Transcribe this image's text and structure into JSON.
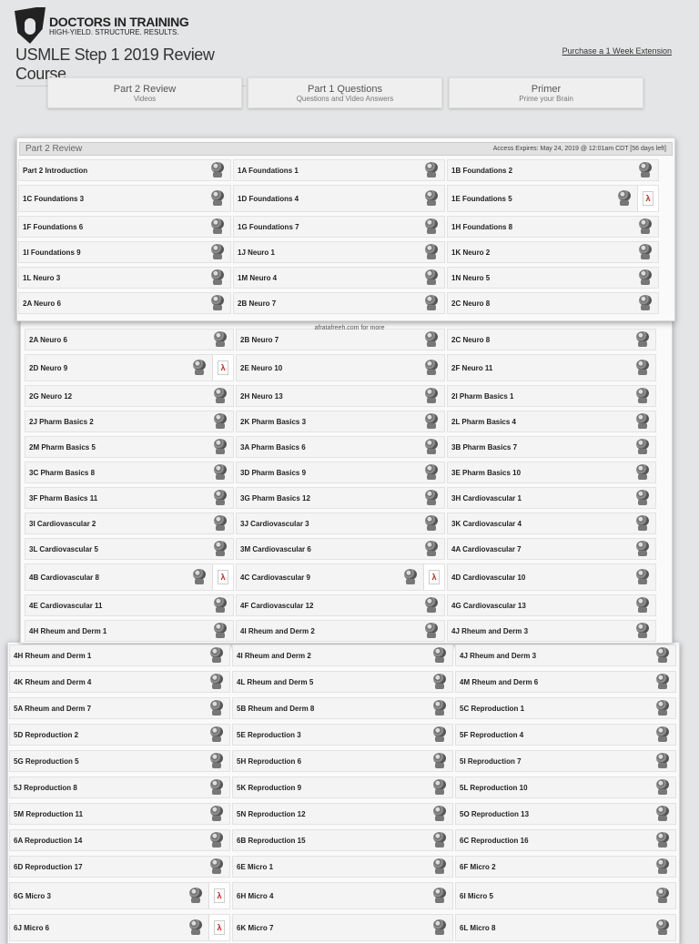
{
  "brand": {
    "name": "DOCTORS IN TRAINING",
    "tagline": "HIGH-YIELD. STRUCTURE. RESULTS."
  },
  "page_title": "USMLE Step 1 2019 Review Course",
  "extension_link": "Purchase a 1 Week Extension",
  "tabs": [
    {
      "title": "Part 2 Review",
      "subtitle": "Videos"
    },
    {
      "title": "Part 1 Questions",
      "subtitle": "Questions and Video Answers"
    },
    {
      "title": "Primer",
      "subtitle": "Prime your Brain"
    }
  ],
  "panel_header": {
    "title": "Part 2 Review",
    "access": "Access Expires: May 24, 2019 @ 12:01am CDT [56 days left]"
  },
  "watermark": "afratafreeh.com for more",
  "sections": [
    {
      "rows": [
        [
          {
            "label": "Part 2 Introduction"
          },
          {
            "label": "1A Foundations 1"
          },
          {
            "label": "1B Foundations 2"
          }
        ],
        [
          {
            "label": "1C Foundations 3"
          },
          {
            "label": "1D Foundations 4"
          },
          {
            "label": "1E Foundations 5",
            "pdf": true
          }
        ],
        [
          {
            "label": "1F Foundations 6"
          },
          {
            "label": "1G Foundations 7"
          },
          {
            "label": "1H Foundations 8"
          }
        ],
        [
          {
            "label": "1I Foundations 9"
          },
          {
            "label": "1J Neuro 1"
          },
          {
            "label": "1K Neuro 2"
          }
        ],
        [
          {
            "label": "1L Neuro 3"
          },
          {
            "label": "1M Neuro 4"
          },
          {
            "label": "1N Neuro 5"
          }
        ],
        [
          {
            "label": "2A Neuro 6"
          },
          {
            "label": "2B Neuro 7"
          },
          {
            "label": "2C Neuro 8"
          }
        ]
      ]
    },
    {
      "rows": [
        [
          {
            "label": "2A Neuro 6"
          },
          {
            "label": "2B Neuro 7"
          },
          {
            "label": "2C Neuro 8"
          }
        ],
        [
          {
            "label": "2D Neuro 9",
            "pdf": true
          },
          {
            "label": "2E Neuro 10"
          },
          {
            "label": "2F Neuro 11"
          }
        ],
        [
          {
            "label": "2G Neuro 12"
          },
          {
            "label": "2H Neuro 13"
          },
          {
            "label": "2I Pharm Basics 1"
          }
        ],
        [
          {
            "label": "2J Pharm Basics 2"
          },
          {
            "label": "2K Pharm Basics 3"
          },
          {
            "label": "2L Pharm Basics 4"
          }
        ],
        [
          {
            "label": "2M Pharm Basics 5"
          },
          {
            "label": "3A Pharm Basics 6"
          },
          {
            "label": "3B Pharm Basics 7"
          }
        ],
        [
          {
            "label": "3C Pharm Basics 8"
          },
          {
            "label": "3D Pharm Basics 9"
          },
          {
            "label": "3E Pharm Basics 10"
          }
        ],
        [
          {
            "label": "3F Pharm Basics 11"
          },
          {
            "label": "3G Pharm Basics 12"
          },
          {
            "label": "3H Cardiovascular 1"
          }
        ],
        [
          {
            "label": "3I Cardiovascular 2"
          },
          {
            "label": "3J Cardiovascular 3"
          },
          {
            "label": "3K Cardiovascular 4"
          }
        ],
        [
          {
            "label": "3L Cardiovascular 5"
          },
          {
            "label": "3M Cardiovascular 6"
          },
          {
            "label": "4A Cardiovascular 7"
          }
        ],
        [
          {
            "label": "4B Cardiovascular 8",
            "pdf": true
          },
          {
            "label": "4C Cardiovascular 9",
            "pdf": true
          },
          {
            "label": "4D Cardiovascular 10"
          }
        ],
        [
          {
            "label": "4E Cardiovascular 11"
          },
          {
            "label": "4F Cardiovascular 12"
          },
          {
            "label": "4G Cardiovascular 13"
          }
        ],
        [
          {
            "label": "4H Rheum and Derm 1"
          },
          {
            "label": "4I Rheum and Derm 2"
          },
          {
            "label": "4J Rheum and Derm 3"
          }
        ]
      ]
    },
    {
      "rows": [
        [
          {
            "label": "4H Rheum and Derm 1"
          },
          {
            "label": "4I Rheum and Derm 2"
          },
          {
            "label": "4J Rheum and Derm 3"
          }
        ],
        [
          {
            "label": "4K Rheum and Derm 4"
          },
          {
            "label": "4L Rheum and Derm 5"
          },
          {
            "label": "4M Rheum and Derm 6"
          }
        ],
        [
          {
            "label": "5A Rheum and Derm 7"
          },
          {
            "label": "5B Rheum and Derm 8"
          },
          {
            "label": "5C Reproduction 1"
          }
        ],
        [
          {
            "label": "5D Reproduction 2"
          },
          {
            "label": "5E Reproduction 3"
          },
          {
            "label": "5F Reproduction 4"
          }
        ],
        [
          {
            "label": "5G Reproduction 5"
          },
          {
            "label": "5H Reproduction 6"
          },
          {
            "label": "5I Reproduction 7"
          }
        ],
        [
          {
            "label": "5J Reproduction 8"
          },
          {
            "label": "5K Reproduction 9"
          },
          {
            "label": "5L Reproduction 10"
          }
        ],
        [
          {
            "label": "5M Reproduction 11"
          },
          {
            "label": "5N Reproduction 12"
          },
          {
            "label": "5O Reproduction 13"
          }
        ],
        [
          {
            "label": "6A Reproduction 14"
          },
          {
            "label": "6B Reproduction 15"
          },
          {
            "label": "6C Reproduction 16"
          }
        ],
        [
          {
            "label": "6D Reproduction 17"
          },
          {
            "label": "6E Micro 1"
          },
          {
            "label": "6F Micro 2"
          }
        ],
        [
          {
            "label": "6G Micro 3",
            "pdf": true
          },
          {
            "label": "6H Micro 4"
          },
          {
            "label": "6I Micro 5"
          }
        ],
        [
          {
            "label": "6J Micro 6",
            "pdf": true
          },
          {
            "label": "6K Micro 7"
          },
          {
            "label": "6L Micro 8"
          }
        ]
      ]
    }
  ]
}
